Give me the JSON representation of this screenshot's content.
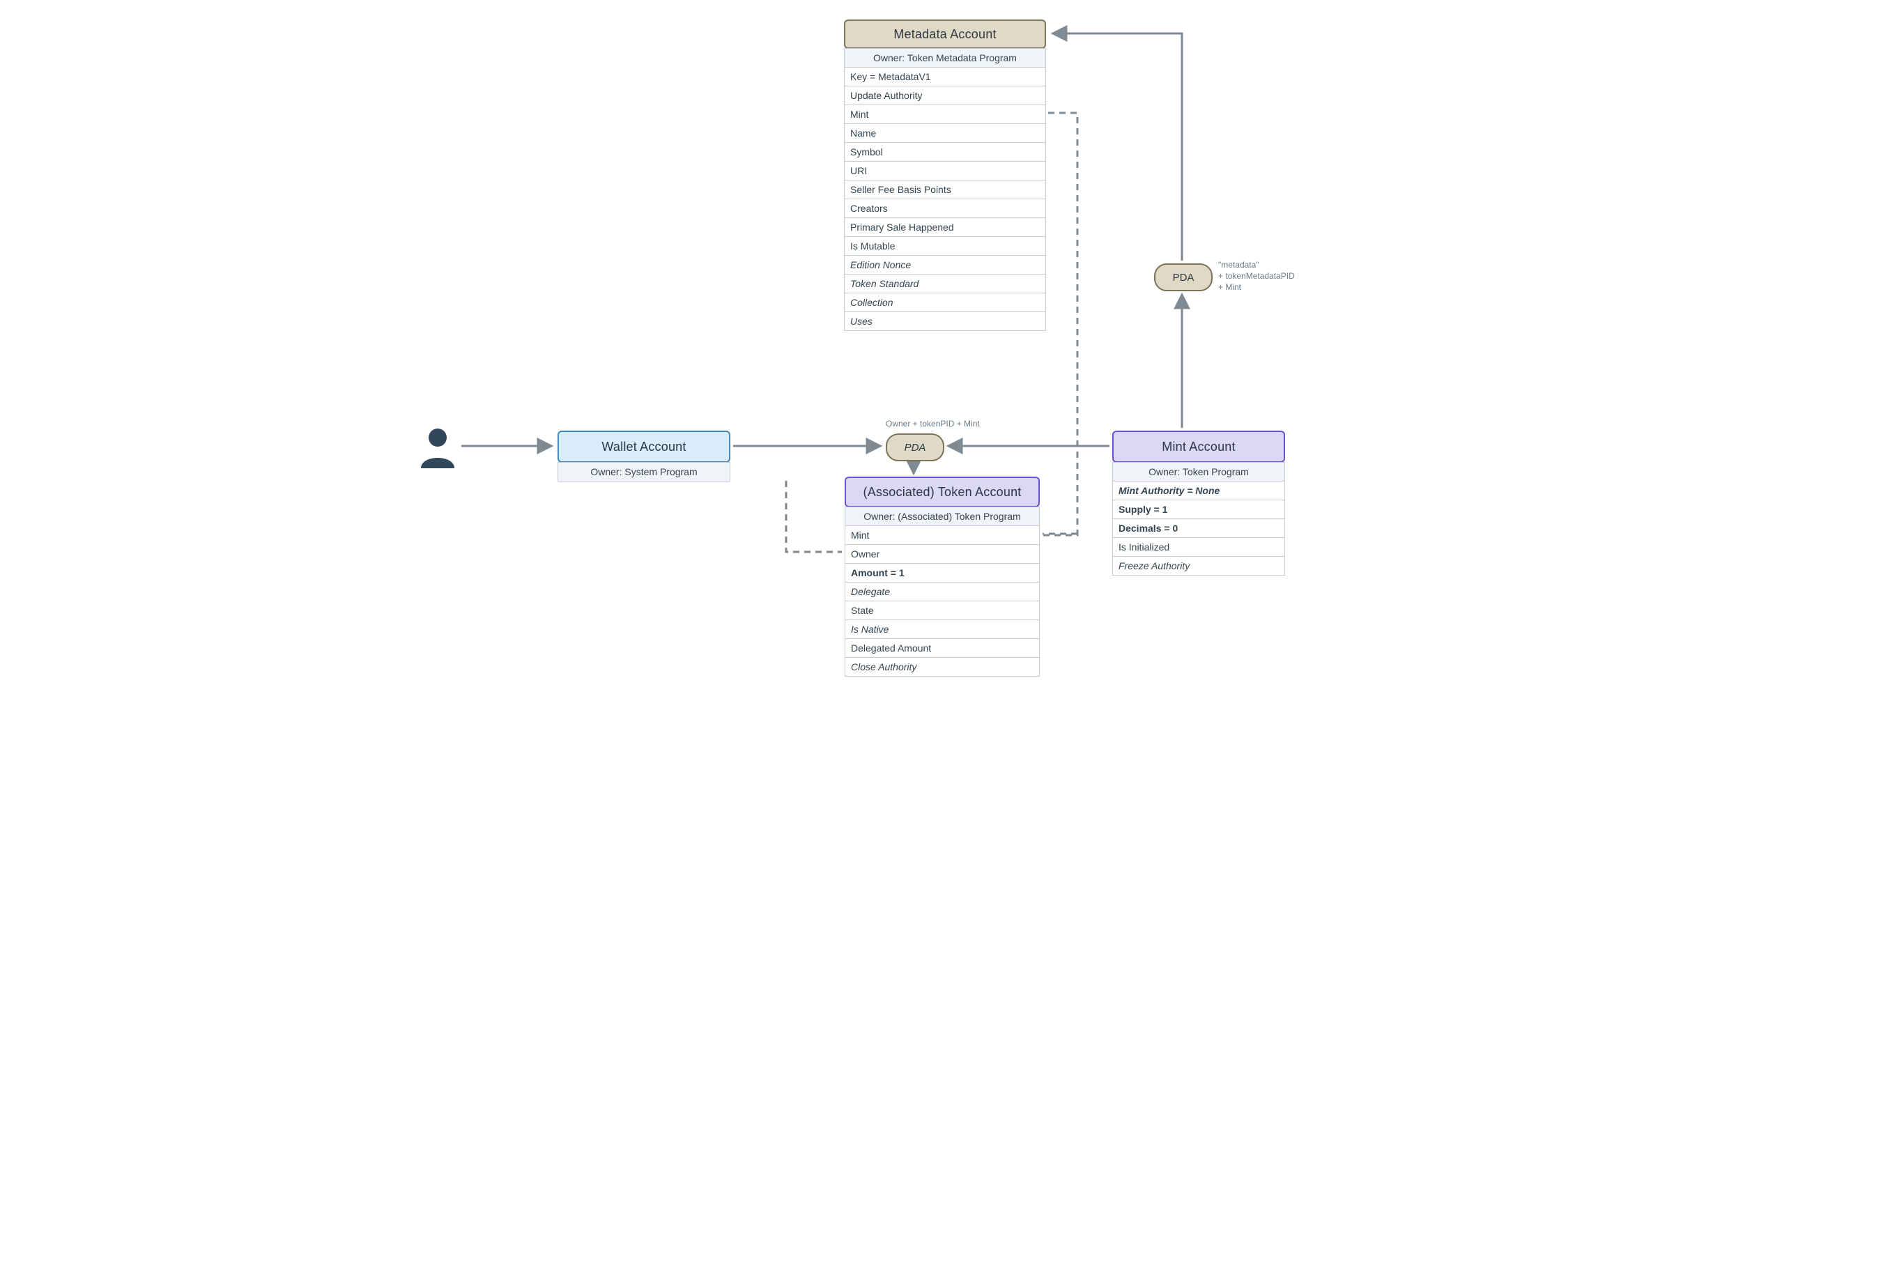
{
  "metadata_account": {
    "title": "Metadata Account",
    "owner": "Owner: Token Metadata Program",
    "fields": [
      {
        "label": "Key = MetadataV1",
        "style": ""
      },
      {
        "label": "Update Authority",
        "style": ""
      },
      {
        "label": "Mint",
        "style": ""
      },
      {
        "label": "Name",
        "style": ""
      },
      {
        "label": "Symbol",
        "style": ""
      },
      {
        "label": "URI",
        "style": ""
      },
      {
        "label": "Seller Fee Basis Points",
        "style": ""
      },
      {
        "label": "Creators",
        "style": ""
      },
      {
        "label": "Primary Sale Happened",
        "style": ""
      },
      {
        "label": "Is Mutable",
        "style": ""
      },
      {
        "label": "Edition Nonce",
        "style": "ital"
      },
      {
        "label": "Token Standard",
        "style": "ital"
      },
      {
        "label": "Collection",
        "style": "ital"
      },
      {
        "label": "Uses",
        "style": "ital"
      }
    ]
  },
  "wallet_account": {
    "title": "Wallet Account",
    "owner": "Owner: System Program"
  },
  "token_account": {
    "title": "(Associated) Token Account",
    "owner": "Owner: (Associated) Token Program",
    "fields": [
      {
        "label": "Mint",
        "style": ""
      },
      {
        "label": "Owner",
        "style": ""
      },
      {
        "label": "Amount = 1",
        "style": "bold"
      },
      {
        "label": "Delegate",
        "style": "ital"
      },
      {
        "label": "State",
        "style": ""
      },
      {
        "label": "Is Native",
        "style": "ital"
      },
      {
        "label": "Delegated Amount",
        "style": ""
      },
      {
        "label": "Close Authority",
        "style": "ital"
      }
    ]
  },
  "mint_account": {
    "title": "Mint Account",
    "owner": "Owner: Token Program",
    "fields": [
      {
        "label": "Mint Authority = None",
        "style": "bold ital"
      },
      {
        "label": "Supply = 1",
        "style": "bold"
      },
      {
        "label": "Decimals = 0",
        "style": "bold"
      },
      {
        "label": "Is Initialized",
        "style": ""
      },
      {
        "label": "Freeze Authority",
        "style": "ital"
      }
    ]
  },
  "pda1": "PDA",
  "pda2": "PDA",
  "tip1": "Owner + tokenPID + Mint",
  "tip2": "\"metadata\"\n+ tokenMetadataPID\n+ Mint"
}
